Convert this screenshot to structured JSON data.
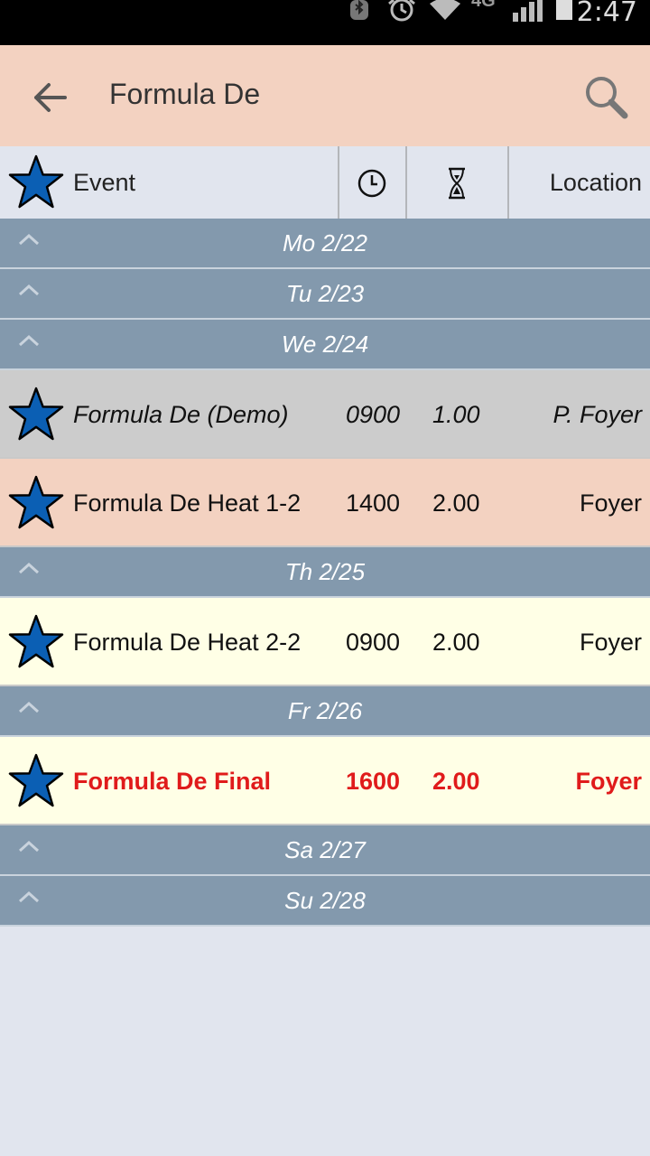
{
  "status_bar": {
    "time": "2:47",
    "network": "4G"
  },
  "app_bar": {
    "title": "Formula De"
  },
  "columns": {
    "event": "Event",
    "location": "Location"
  },
  "colors": {
    "app_bar": "#f3d2c1",
    "group_header": "#8399ad",
    "demo_row": "#cccccc",
    "selected_row": "#f3d2c1",
    "normal_row": "#ffffe6",
    "highlight_text": "#e01b1b",
    "star": "#0b5fb4"
  },
  "groups": [
    {
      "label": "Mo 2/22",
      "events": []
    },
    {
      "label": "Tu 2/23",
      "events": []
    },
    {
      "label": "We 2/24",
      "events": [
        {
          "name": "Formula De (Demo)",
          "time": "0900",
          "duration": "1.00",
          "location": "P. Foyer",
          "style": "demo"
        },
        {
          "name": "Formula De Heat 1-2",
          "time": "1400",
          "duration": "2.00",
          "location": "Foyer",
          "style": "selected"
        }
      ]
    },
    {
      "label": "Th 2/25",
      "events": [
        {
          "name": "Formula De Heat 2-2",
          "time": "0900",
          "duration": "2.00",
          "location": "Foyer",
          "style": "normal"
        }
      ]
    },
    {
      "label": "Fr 2/26",
      "events": [
        {
          "name": "Formula De Final",
          "time": "1600",
          "duration": "2.00",
          "location": "Foyer",
          "style": "final"
        }
      ]
    },
    {
      "label": "Sa 2/27",
      "events": []
    },
    {
      "label": "Su 2/28",
      "events": []
    }
  ]
}
